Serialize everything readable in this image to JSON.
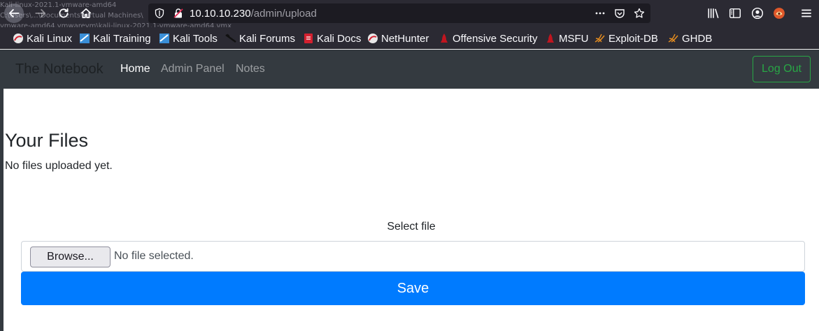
{
  "browser": {
    "url_host": "10.10.10.230",
    "url_path": "/admin/upload",
    "ghost_lines": [
      "Kali-linux-2021.1-vmware-amd64",
      "C:\\Users\\...\\Documents\\Virtual Machines\\",
      "vmware-amd64.vmwarevm\\kali-linux-2021.1-vmware-amd64.vmx"
    ],
    "bookmarks": [
      {
        "label": "Kali Linux",
        "icon": "kali-linux-icon"
      },
      {
        "label": "Kali Training",
        "icon": "kali-training-icon"
      },
      {
        "label": "Kali Tools",
        "icon": "kali-tools-icon"
      },
      {
        "label": "Kali Forums",
        "icon": "kali-forums-icon"
      },
      {
        "label": "Kali Docs",
        "icon": "kali-docs-icon"
      },
      {
        "label": "NetHunter",
        "icon": "nethunter-icon"
      },
      {
        "label": "Offensive Security",
        "icon": "offensive-security-icon"
      },
      {
        "label": "MSFU",
        "icon": "msfu-icon"
      },
      {
        "label": "Exploit-DB",
        "icon": "exploit-db-icon"
      },
      {
        "label": "GHDB",
        "icon": "ghdb-icon"
      }
    ]
  },
  "site": {
    "brand": "The Notebook",
    "nav": {
      "home": "Home",
      "admin": "Admin Panel",
      "notes": "Notes"
    },
    "logout": "Log Out"
  },
  "files": {
    "title": "Your Files",
    "empty_message": "No files uploaded yet.",
    "select_label": "Select file",
    "browse_label": "Browse...",
    "file_status": "No file selected.",
    "save_label": "Save"
  },
  "colors": {
    "navbar": "#343a40",
    "primary": "#007bff",
    "success": "#28a745",
    "chrome": "#2b2a33"
  }
}
